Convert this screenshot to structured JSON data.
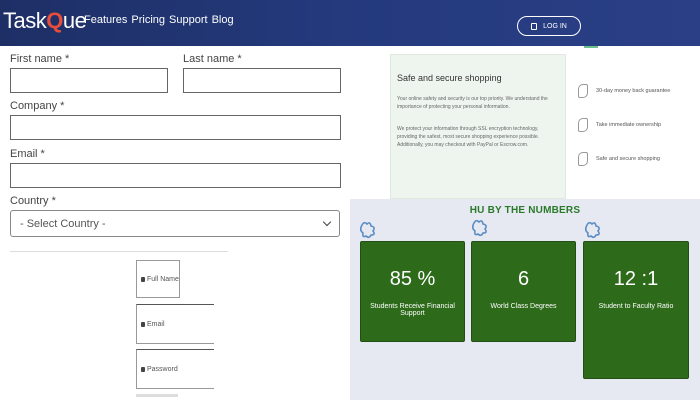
{
  "header": {
    "logo_prefix": "Task",
    "logo_accent": "Q",
    "logo_suffix": "ue",
    "nav": [
      "Features",
      "Pricing",
      "Support",
      "Blog"
    ],
    "login_label": "LOG IN"
  },
  "form": {
    "first_name_label": "First name *",
    "last_name_label": "Last name *",
    "company_label": "Company *",
    "email_label": "Email *",
    "country_label": "Country *",
    "country_selected": "- Select Country -",
    "mini_full_name": "Full Name",
    "mini_email": "Email",
    "mini_password": "Password"
  },
  "secure": {
    "title": "Safe and secure shopping",
    "p1": "Your online safety and security is our top priority. We understand the importance of protecting your personal information.",
    "p2": "We protect your information through SSL encryption technology, providing the safest, most secure shopping experience possible. Additionally, you may checkout with PayPal or Escrow.com.",
    "guarantees": [
      "30-day money back guarantee",
      "Take immediate ownership",
      "Safe and secure shopping"
    ]
  },
  "numbers": {
    "title": "HU BY THE NUMBERS",
    "stats": [
      {
        "value": "85 %",
        "caption": "Students Receive Financial Support"
      },
      {
        "value": "6",
        "caption": "World Class Degrees"
      },
      {
        "value": "12 :1",
        "caption": "Student to Faculty Ratio"
      }
    ]
  },
  "colors": {
    "header_bg": "#243a7d",
    "logo_accent": "#e84d3c",
    "stat_bg": "#2d6a1a",
    "numbers_title": "#2a7a2a",
    "numbers_bg": "#e6e9f2"
  }
}
